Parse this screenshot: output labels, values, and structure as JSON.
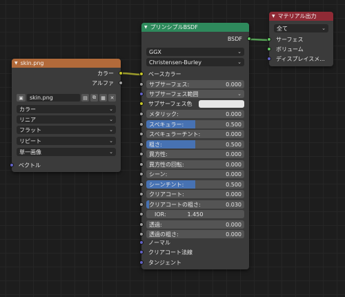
{
  "colors": {
    "image_header": "#b26a3a",
    "bsdf_header": "#2e8a5c",
    "output_header": "#8f2a35",
    "color_socket": "#c7c729",
    "float_socket": "#a1a1a1",
    "vector_socket": "#6363c7",
    "shader_socket": "#63c763",
    "slider_fill": "#4772b3"
  },
  "image_node": {
    "title": "skin.png",
    "outputs": [
      "カラー",
      "アルファ"
    ],
    "image_name": "skin.png",
    "dropdowns": [
      "カラー",
      "リニア",
      "フラット",
      "リピート",
      "単一画像"
    ],
    "input_vector": "ベクトル"
  },
  "bsdf_node": {
    "title": "プリンシプルBSDF",
    "output": "BSDF",
    "distribution": "GGX",
    "subsurface_method": "Christensen-Burley",
    "base_color": "ベースカラー",
    "subsurface": {
      "label": "サブサーフェス:",
      "value": "0.000"
    },
    "subsurface_radius": "サブサーフェス範囲",
    "subsurface_color": "サブサーフェス色",
    "metallic": {
      "label": "メタリック:",
      "value": "0.000"
    },
    "specular": {
      "label": "スペキュラー:",
      "value": "0.500",
      "fill": 0.5
    },
    "specular_tint": {
      "label": "スペキュラーチント:",
      "value": "0.000"
    },
    "roughness": {
      "label": "粗さ:",
      "value": "0.500",
      "fill": 0.5
    },
    "anisotropic": {
      "label": "異方性:",
      "value": "0.000"
    },
    "anisotropic_rotation": {
      "label": "異方性の回転:",
      "value": "0.000"
    },
    "sheen": {
      "label": "シーン:",
      "value": "0.000"
    },
    "sheen_tint": {
      "label": "シーンチント:",
      "value": "0.500",
      "fill": 0.5
    },
    "clearcoat": {
      "label": "クリアコート:",
      "value": "0.000"
    },
    "clearcoat_roughness": {
      "label": "クリアコートの粗さ:",
      "value": "0.030",
      "fill": 0.03
    },
    "ior": {
      "label": "IOR:",
      "value": "1.450"
    },
    "transmission": {
      "label": "透過:",
      "value": "0.000"
    },
    "transmission_roughness": {
      "label": "透過の粗さ:",
      "value": "0.000"
    },
    "normal": "ノーマル",
    "clearcoat_normal": "クリアコート法線",
    "tangent": "タンジェント"
  },
  "output_node": {
    "title": "マテリアル出力",
    "target": "全て",
    "inputs": [
      "サーフェス",
      "ボリューム",
      "ディスプレイスメ..."
    ]
  }
}
